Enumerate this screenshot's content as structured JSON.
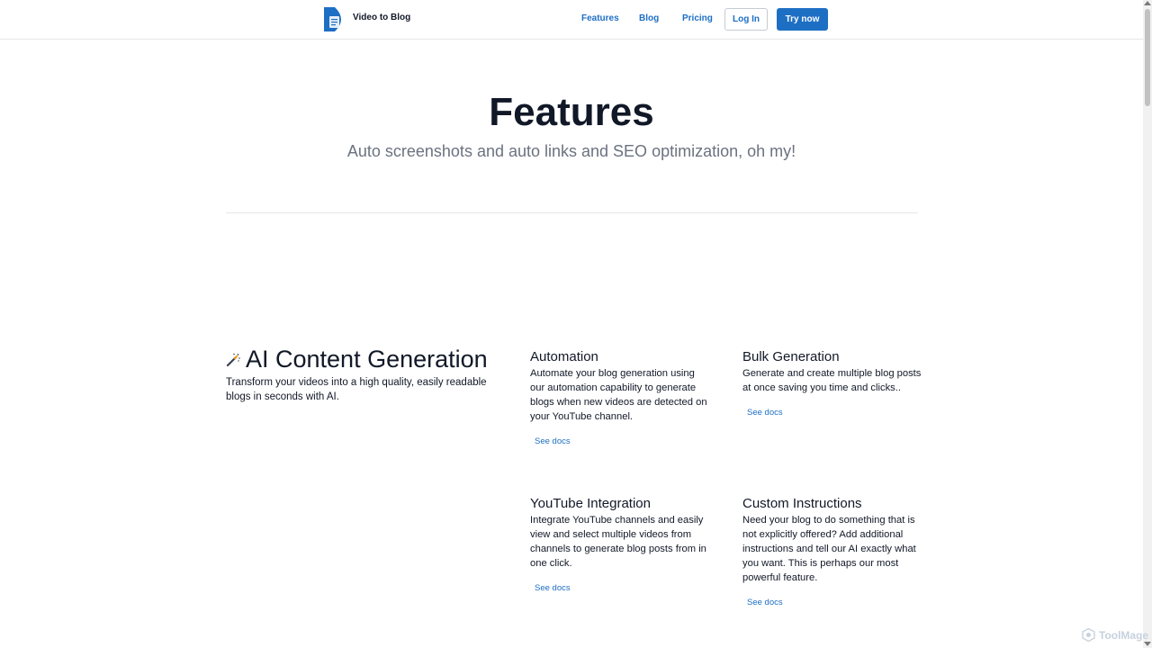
{
  "header": {
    "brand": "Video to Blog",
    "nav": {
      "features": "Features",
      "blog": "Blog",
      "pricing": "Pricing"
    },
    "login": "Log In",
    "try_now": "Try now"
  },
  "hero": {
    "title": "Features",
    "subtitle": "Auto screenshots and auto links and SEO optimization, oh my!"
  },
  "main_feature": {
    "title": "AI Content Generation",
    "description": "Transform your videos into a high quality, easily readable blogs in seconds with AI."
  },
  "features": [
    {
      "title": "Automation",
      "description": "Automate your blog generation using our automation capability to generate blogs when new videos are detected on your YouTube channel.",
      "link": "See docs"
    },
    {
      "title": "Bulk Generation",
      "description": "Generate and create multiple blog posts at once saving you time and clicks..",
      "link": "See docs"
    },
    {
      "title": "YouTube Integration",
      "description": "Integrate YouTube channels and easily view and select multiple videos from channels to generate blog posts from in one click.",
      "link": "See docs"
    },
    {
      "title": "Custom Instructions",
      "description": "Need your blog to do something that is not explicitly offered? Add additional instructions and tell our AI exactly what you want. This is perhaps our most powerful feature.",
      "link": "See docs"
    }
  ],
  "watermark": "ToolMage",
  "colors": {
    "accent": "#1d6fc4",
    "text": "#111827",
    "muted": "#6b7280"
  }
}
